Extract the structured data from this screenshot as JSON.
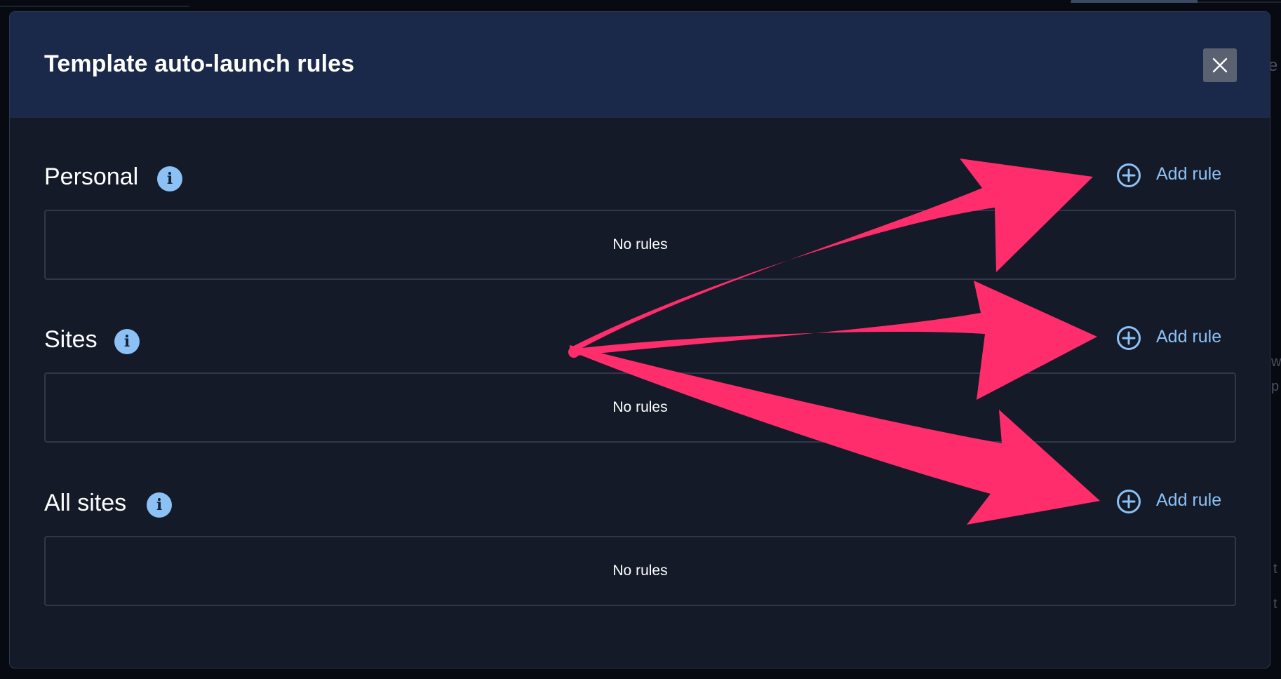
{
  "dialog": {
    "title": "Template auto-launch rules",
    "close_icon": "close-icon"
  },
  "sections": [
    {
      "title": "Personal",
      "info_icon": "info-icon",
      "add_label": "Add rule",
      "add_icon": "plus-circle-icon",
      "empty_text": "No rules"
    },
    {
      "title": "Sites",
      "info_icon": "info-icon",
      "add_label": "Add rule",
      "add_icon": "plus-circle-icon",
      "empty_text": "No rules"
    },
    {
      "title": "All sites",
      "info_icon": "info-icon",
      "add_label": "Add rule",
      "add_icon": "plus-circle-icon",
      "empty_text": "No rules"
    }
  ],
  "colors": {
    "header_bg": "#1a2849",
    "body_bg": "#141a28",
    "accent": "#8cc1f5",
    "annotation_arrow": "#ff2d6b"
  }
}
